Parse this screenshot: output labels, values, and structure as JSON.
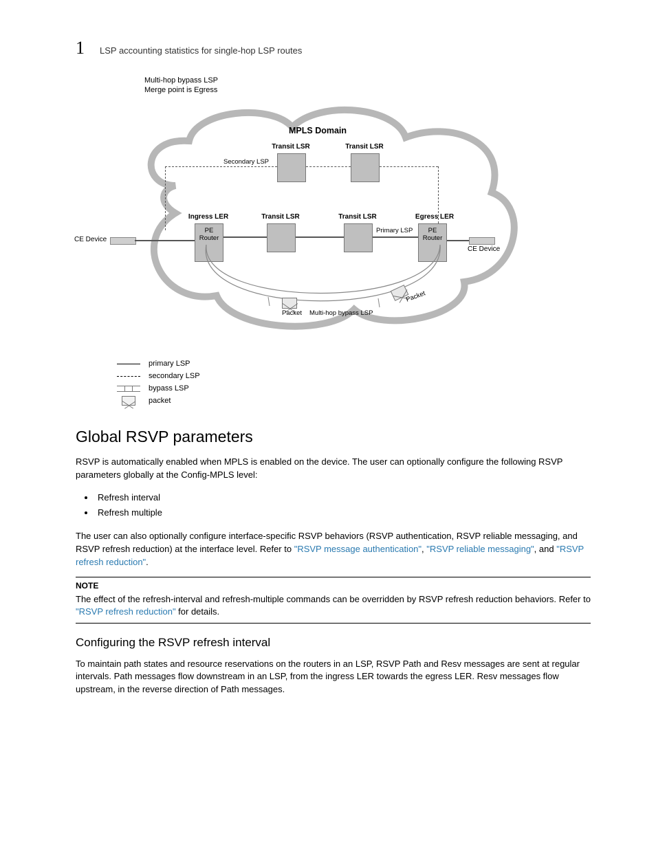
{
  "header": {
    "chapter_number": "1",
    "running_title": "LSP accounting statistics for single-hop LSP routes"
  },
  "figure": {
    "caption_line1": "Multi-hop bypass LSP",
    "caption_line2": "Merge point is Egress",
    "domain_label": "MPLS Domain",
    "top_transit1": "Transit LSR",
    "top_transit2": "Transit LSR",
    "secondary_lsp": "Secondary LSP",
    "ingress_ler": "Ingress LER",
    "mid_transit1": "Transit LSR",
    "mid_transit2": "Transit LSR",
    "egress_ler": "Egress LER",
    "pe_router": "PE Router",
    "primary_lsp": "Primary LSP",
    "ce_device": "CE Device",
    "packet": "Packet",
    "bypass_label": "Multi-hop bypass LSP"
  },
  "legend": {
    "primary": "primary LSP",
    "secondary": "secondary LSP",
    "bypass": "bypass LSP",
    "packet": "packet"
  },
  "section1": {
    "title": "Global RSVP parameters",
    "p1": "RSVP is automatically enabled when MPLS is enabled on the device. The user can optionally configure the following RSVP parameters globally at the Config-MPLS level:",
    "bullet1": "Refresh interval",
    "bullet2": "Refresh multiple",
    "p2_a": "The user can also optionally configure interface-specific RSVP behaviors (RSVP authentication, RSVP reliable messaging, and RSVP refresh reduction) at the interface level. Refer to ",
    "link1": "\"RSVP message authentication\"",
    "p2_b": ", ",
    "link2": "\"RSVP reliable messaging\"",
    "p2_c": ", and ",
    "link3": "\"RSVP refresh reduction\"",
    "p2_d": "."
  },
  "note": {
    "head": "NOTE",
    "body_a": "The effect of the refresh-interval and refresh-multiple commands can be overridden by RSVP refresh reduction behaviors. Refer to ",
    "link": "\"RSVP refresh reduction\"",
    "body_b": " for details."
  },
  "section2": {
    "title": "Configuring the RSVP refresh interval",
    "p1": "To maintain path states and resource reservations on the routers in an LSP, RSVP Path and Resv messages are sent at regular intervals. Path messages flow downstream in an LSP, from the ingress LER towards the egress LER. Resv messages flow upstream, in the reverse direction of Path messages."
  }
}
